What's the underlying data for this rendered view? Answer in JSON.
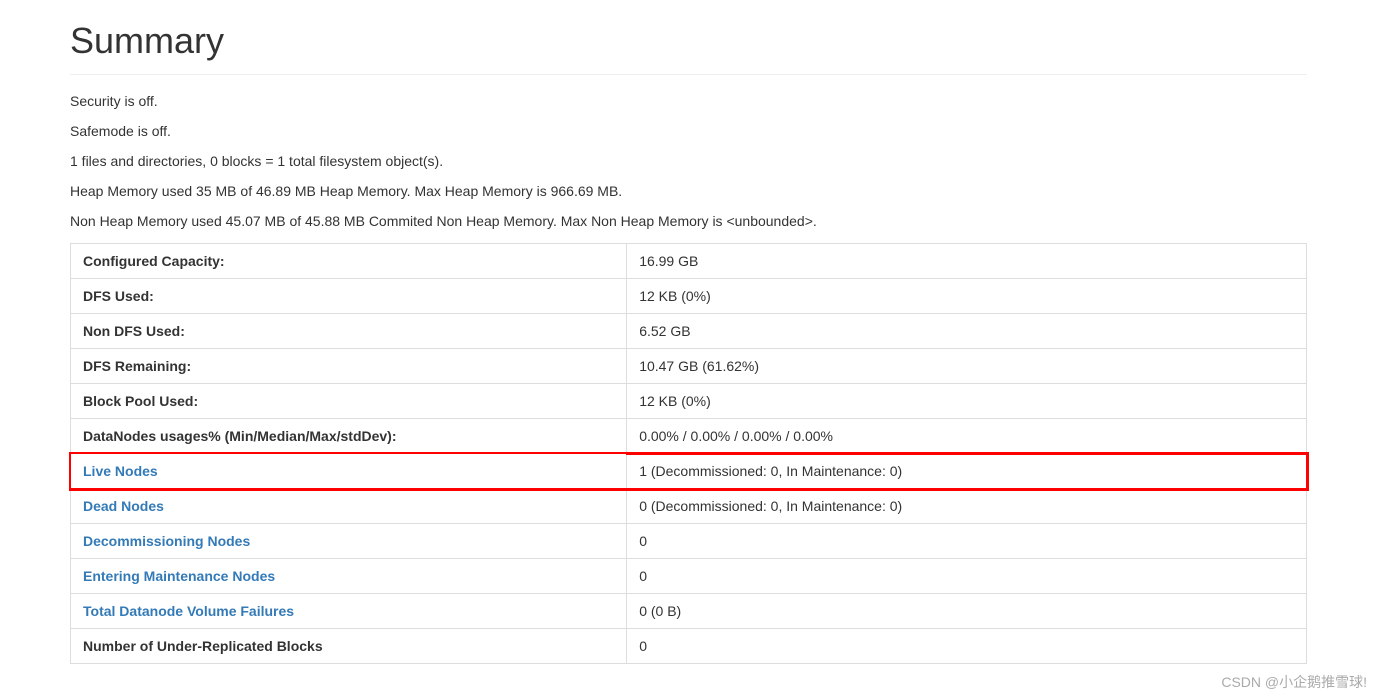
{
  "heading": "Summary",
  "status": {
    "security": "Security is off.",
    "safemode": "Safemode is off.",
    "filesystem": "1 files and directories, 0 blocks = 1 total filesystem object(s).",
    "heap": "Heap Memory used 35 MB of 46.89 MB Heap Memory. Max Heap Memory is 966.69 MB.",
    "nonheap": "Non Heap Memory used 45.07 MB of 45.88 MB Commited Non Heap Memory. Max Non Heap Memory is <unbounded>."
  },
  "rows": {
    "configured_capacity": {
      "label": "Configured Capacity:",
      "value": "16.99 GB"
    },
    "dfs_used": {
      "label": "DFS Used:",
      "value": "12 KB (0%)"
    },
    "non_dfs_used": {
      "label": "Non DFS Used:",
      "value": "6.52 GB"
    },
    "dfs_remaining": {
      "label": "DFS Remaining:",
      "value": "10.47 GB (61.62%)"
    },
    "block_pool_used": {
      "label": "Block Pool Used:",
      "value": "12 KB (0%)"
    },
    "datanodes_usages": {
      "label": "DataNodes usages% (Min/Median/Max/stdDev):",
      "value": "0.00% / 0.00% / 0.00% / 0.00%"
    },
    "live_nodes": {
      "label": "Live Nodes",
      "value": "1 (Decommissioned: 0, In Maintenance: 0)"
    },
    "dead_nodes": {
      "label": "Dead Nodes",
      "value": "0 (Decommissioned: 0, In Maintenance: 0)"
    },
    "decommissioning_nodes": {
      "label": "Decommissioning Nodes",
      "value": "0"
    },
    "entering_maintenance_nodes": {
      "label": "Entering Maintenance Nodes",
      "value": "0"
    },
    "total_volume_failures": {
      "label": "Total Datanode Volume Failures",
      "value": "0 (0 B)"
    },
    "under_replicated_blocks": {
      "label": "Number of Under-Replicated Blocks",
      "value": "0"
    }
  },
  "watermark": "CSDN @小企鹅推雪球!"
}
